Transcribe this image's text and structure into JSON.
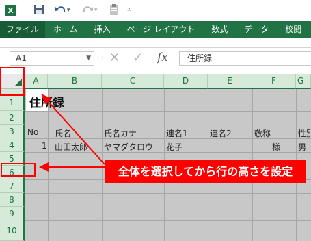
{
  "quick_access": {
    "app_icon": "X",
    "icons": [
      "excel-logo-icon",
      "save-icon",
      "undo-icon",
      "redo-icon",
      "paste-icon",
      "customize-icon"
    ]
  },
  "ribbon": {
    "tabs": [
      "ファイル",
      "ホーム",
      "挿入",
      "ページ レイアウト",
      "数式",
      "データ",
      "校閲"
    ],
    "active_tab": "ファイル",
    "tab_color": "#217346"
  },
  "formula_bar": {
    "name_box": "A1",
    "content": "住所録",
    "fx_label": "fx",
    "cancel_symbol": "✕",
    "enter_symbol": "✓"
  },
  "sheet": {
    "columns": [
      "A",
      "B",
      "C",
      "D",
      "E",
      "F",
      "G"
    ],
    "rows": [
      "1",
      "2",
      "3",
      "4",
      "5",
      "6",
      "7",
      "8",
      "9",
      "10"
    ],
    "title": "住所録",
    "header": [
      "No",
      "氏名",
      "氏名カナ",
      "連名1",
      "連名2",
      "敬称",
      "性別"
    ],
    "record": [
      "1",
      "山田太郎",
      "ヤマダタロウ",
      "花子",
      "",
      "様",
      "男"
    ],
    "selection_fill": "#c8c8c8"
  },
  "annotation": {
    "text": "全体を選択してから行の高さを設定",
    "color": "#ff0000"
  }
}
